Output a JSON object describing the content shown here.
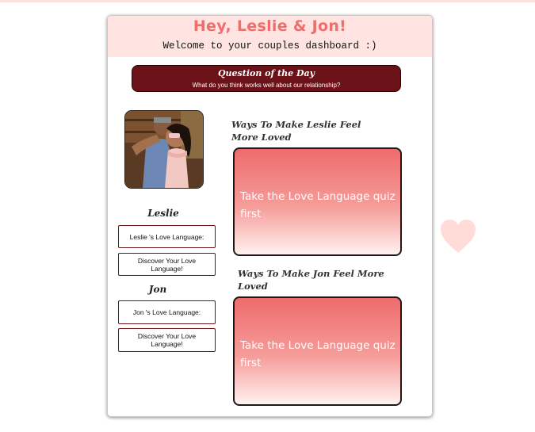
{
  "header": {
    "title": "Hey, Leslie & Jon!",
    "subtitle": "Welcome to your couples dashboard :)"
  },
  "question_of_the_day": {
    "title": "Question of the Day",
    "text": "What do you think works well about our relationship?"
  },
  "partners": [
    {
      "name": "Leslie",
      "love_language_label": "Leslie 's Love Language:",
      "discover_label": "Discover Your Love Language!",
      "ways_title": "Ways To Make Leslie Feel More Loved",
      "ways_text": "Take the Love Language quiz first"
    },
    {
      "name": "Jon",
      "love_language_label": "Jon 's Love Language:",
      "discover_label": "Discover Your Love Language!",
      "ways_title": "Ways To Make Jon Feel More Loved",
      "ways_text": "Take the Love Language quiz first"
    }
  ],
  "colors": {
    "accent": "#ee6d6d",
    "header_bg": "#ffe4e1",
    "qotd_bg": "#6b1118",
    "heart": "#ffdcd8"
  },
  "icons": {
    "decoration": "heart-icon",
    "photo": "couple-photo"
  }
}
